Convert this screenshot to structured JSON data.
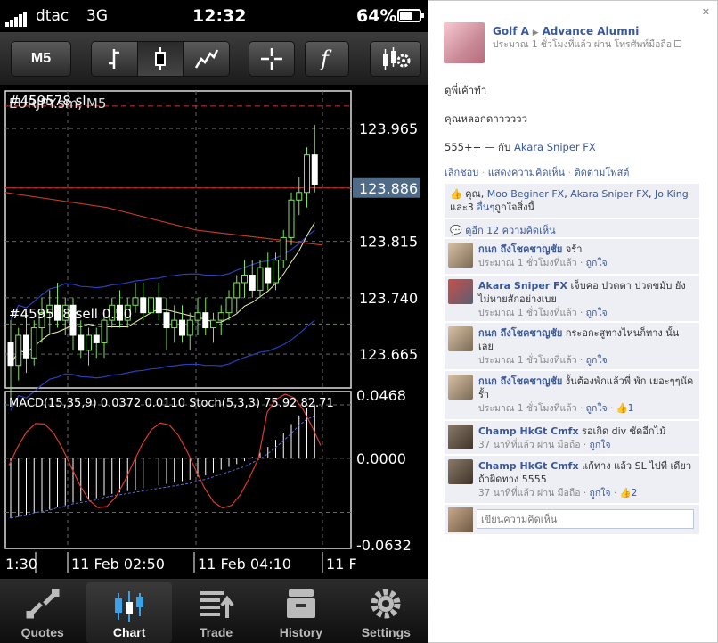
{
  "status": {
    "carrier": "dtac",
    "network": "3G",
    "time": "12:32",
    "battery": "64%"
  },
  "toolbar": {
    "timeframe": "M5"
  },
  "chart_data": {
    "type": "candlestick",
    "symbol_label": "EURJPY.sm, M5",
    "order_label_top": "#459578 sl",
    "order_label_sell": "#459578 sell 0.50",
    "current_price": "123.886",
    "price_ticks": [
      "123.965",
      "123.886",
      "123.815",
      "123.740",
      "123.665"
    ],
    "price_tick_values": [
      123.965,
      123.886,
      123.815,
      123.74,
      123.665
    ],
    "price_range": [
      123.62,
      124.015
    ],
    "candles": [
      {
        "o": 123.68,
        "h": 123.71,
        "l": 123.6,
        "c": 123.65
      },
      {
        "o": 123.65,
        "h": 123.7,
        "l": 123.63,
        "c": 123.69
      },
      {
        "o": 123.69,
        "h": 123.72,
        "l": 123.64,
        "c": 123.66
      },
      {
        "o": 123.66,
        "h": 123.71,
        "l": 123.65,
        "c": 123.7
      },
      {
        "o": 123.7,
        "h": 123.74,
        "l": 123.68,
        "c": 123.72
      },
      {
        "o": 123.72,
        "h": 123.75,
        "l": 123.69,
        "c": 123.73
      },
      {
        "o": 123.73,
        "h": 123.76,
        "l": 123.7,
        "c": 123.71
      },
      {
        "o": 123.71,
        "h": 123.74,
        "l": 123.69,
        "c": 123.73
      },
      {
        "o": 123.73,
        "h": 123.74,
        "l": 123.67,
        "c": 123.69
      },
      {
        "o": 123.69,
        "h": 123.71,
        "l": 123.66,
        "c": 123.67
      },
      {
        "o": 123.67,
        "h": 123.7,
        "l": 123.65,
        "c": 123.69
      },
      {
        "o": 123.69,
        "h": 123.7,
        "l": 123.66,
        "c": 123.68
      },
      {
        "o": 123.68,
        "h": 123.72,
        "l": 123.66,
        "c": 123.71
      },
      {
        "o": 123.71,
        "h": 123.74,
        "l": 123.7,
        "c": 123.73
      },
      {
        "o": 123.73,
        "h": 123.75,
        "l": 123.7,
        "c": 123.71
      },
      {
        "o": 123.71,
        "h": 123.74,
        "l": 123.7,
        "c": 123.73
      },
      {
        "o": 123.73,
        "h": 123.76,
        "l": 123.72,
        "c": 123.74
      },
      {
        "o": 123.74,
        "h": 123.76,
        "l": 123.71,
        "c": 123.72
      },
      {
        "o": 123.72,
        "h": 123.75,
        "l": 123.71,
        "c": 123.74
      },
      {
        "o": 123.74,
        "h": 123.76,
        "l": 123.71,
        "c": 123.72
      },
      {
        "o": 123.72,
        "h": 123.74,
        "l": 123.67,
        "c": 123.7
      },
      {
        "o": 123.7,
        "h": 123.73,
        "l": 123.68,
        "c": 123.71
      },
      {
        "o": 123.71,
        "h": 123.73,
        "l": 123.68,
        "c": 123.69
      },
      {
        "o": 123.69,
        "h": 123.72,
        "l": 123.67,
        "c": 123.71
      },
      {
        "o": 123.71,
        "h": 123.74,
        "l": 123.69,
        "c": 123.72
      },
      {
        "o": 123.72,
        "h": 123.74,
        "l": 123.69,
        "c": 123.7
      },
      {
        "o": 123.7,
        "h": 123.72,
        "l": 123.68,
        "c": 123.71
      },
      {
        "o": 123.71,
        "h": 123.73,
        "l": 123.69,
        "c": 123.72
      },
      {
        "o": 123.72,
        "h": 123.75,
        "l": 123.71,
        "c": 123.74
      },
      {
        "o": 123.74,
        "h": 123.77,
        "l": 123.72,
        "c": 123.76
      },
      {
        "o": 123.76,
        "h": 123.79,
        "l": 123.74,
        "c": 123.77
      },
      {
        "o": 123.77,
        "h": 123.79,
        "l": 123.74,
        "c": 123.75
      },
      {
        "o": 123.75,
        "h": 123.79,
        "l": 123.74,
        "c": 123.78
      },
      {
        "o": 123.78,
        "h": 123.8,
        "l": 123.75,
        "c": 123.76
      },
      {
        "o": 123.76,
        "h": 123.8,
        "l": 123.75,
        "c": 123.79
      },
      {
        "o": 123.79,
        "h": 123.83,
        "l": 123.78,
        "c": 123.82
      },
      {
        "o": 123.82,
        "h": 123.88,
        "l": 123.81,
        "c": 123.87
      },
      {
        "o": 123.87,
        "h": 123.9,
        "l": 123.85,
        "c": 123.88
      },
      {
        "o": 123.88,
        "h": 123.94,
        "l": 123.86,
        "c": 123.93
      },
      {
        "o": 123.93,
        "h": 123.97,
        "l": 123.88,
        "c": 123.89
      }
    ],
    "indicator_label": "MACD(15,35,9) 0.0372 0.0110 Stoch(5,3,3) 75.92 82.71",
    "indicator_ticks": [
      "0.0468",
      "0.0000",
      "-0.0632"
    ],
    "macd_histogram": [
      -0.042,
      -0.041,
      -0.04,
      -0.038,
      -0.037,
      -0.036,
      -0.034,
      -0.033,
      -0.031,
      -0.03,
      -0.029,
      -0.028,
      -0.026,
      -0.025,
      -0.024,
      -0.023,
      -0.022,
      -0.021,
      -0.02,
      -0.019,
      -0.018,
      -0.017,
      -0.016,
      -0.015,
      -0.013,
      -0.012,
      -0.01,
      -0.008,
      -0.006,
      -0.004,
      -0.002,
      0.001,
      0.004,
      0.008,
      0.013,
      0.018,
      0.024,
      0.03,
      0.035,
      0.037
    ],
    "time_labels": [
      "1:30",
      "11 Feb 02:50",
      "11 Feb 04:10",
      "11 F"
    ]
  },
  "tabs": [
    {
      "label": "Quotes",
      "icon": "quotes-icon"
    },
    {
      "label": "Chart",
      "icon": "chart-icon"
    },
    {
      "label": "Trade",
      "icon": "trade-icon"
    },
    {
      "label": "History",
      "icon": "history-icon"
    },
    {
      "label": "Settings",
      "icon": "settings-icon"
    }
  ],
  "post": {
    "author": "Golf A",
    "target": "Advance Alumni",
    "meta": "ประมาณ 1 ชั่วโมงที่แล้ว ผ่าน โทรศัพท์มือถือ",
    "line1": "ดูพี่เค้าทำ",
    "line2": "คุณหลอกดาววววว",
    "line3_text": "555++ — กับ",
    "line3_link": "Akara Sniper FX",
    "actions": [
      "เลิกชอบ",
      "แสดงความคิดเห็น",
      "ติดตามโพสต์"
    ],
    "likes_prefix": "คุณ,",
    "likes_names": [
      "Moo Beginer FX",
      "Akara Sniper FX",
      "Jo King"
    ],
    "likes_others": "อื่นๆ",
    "likes_and": "และ3",
    "likes_suffix": "ถูกใจสิ่งนี้",
    "view_more": "ดูอีก 12 ความคิดเห็น",
    "comments": [
      {
        "name": "กนก ถึงโชคชาญชัย",
        "text": "จร้า",
        "time": "ประมาณ 1 ชั่วโมงที่แล้ว",
        "like": "ถูกใจ",
        "count": ""
      },
      {
        "name": "Akara Sniper FX",
        "text": "เจ็บคอ ปวดตา ปวดขมับ ยังไม่หายสักอย่างเบย",
        "time": "ประมาณ 1 ชั่วโมงที่แล้ว",
        "like": "ถูกใจ",
        "count": ""
      },
      {
        "name": "กนก ถึงโชคชาญชัย",
        "text": "กระอกะสูทางไหนก็ทาง นั้นเลย",
        "time": "ประมาณ 1 ชั่วโมงที่แล้ว",
        "like": "ถูกใจ",
        "count": ""
      },
      {
        "name": "กนก ถึงโชคชาญชัย",
        "text": "งั้นต้องพักแล้วพี่ พัก เยอะๆๆนัครั้า",
        "time": "ประมาณ 1 ชั่วโมงที่แล้ว",
        "like": "ถูกใจ",
        "count": "1"
      },
      {
        "name": "Champ HkGt Cmfx",
        "text": "รอเกิด div ซัดอีกไม้",
        "time": "37 นาทีที่แล้ว ผ่าน มือถือ",
        "like": "ถูกใจ",
        "count": ""
      },
      {
        "name": "Champ HkGt Cmfx",
        "text": "แก้ทาง แล้ว SL ไปที เดียวถ้าผิดทาง 5555",
        "time": "37 นาทีที่แล้ว ผ่าน มือถือ",
        "like": "ถูกใจ",
        "count": "2"
      }
    ],
    "reply_placeholder": "เขียนความคิดเห็น"
  }
}
